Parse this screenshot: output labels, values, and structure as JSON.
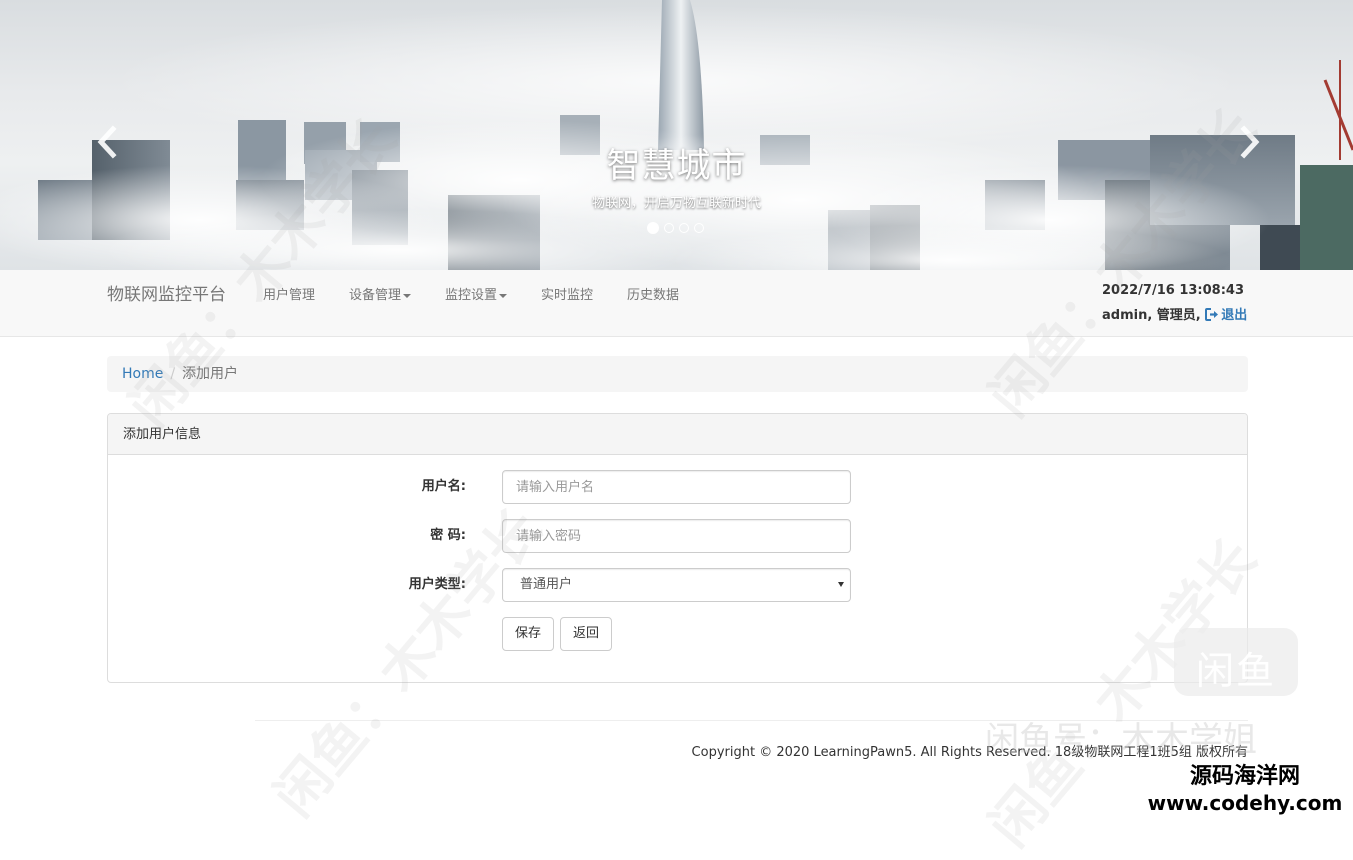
{
  "banner": {
    "title": "智慧城市",
    "subtitle": "物联网，开启万物互联新时代",
    "slide_count": 4,
    "active_slide": 1
  },
  "navbar": {
    "brand": "物联网监控平台",
    "items": [
      {
        "label": "用户管理",
        "dropdown": false
      },
      {
        "label": "设备管理",
        "dropdown": true
      },
      {
        "label": "监控设置",
        "dropdown": true
      },
      {
        "label": "实时监控",
        "dropdown": false
      },
      {
        "label": "历史数据",
        "dropdown": false
      }
    ],
    "datetime": "2022/7/16 13:08:43",
    "user": "admin, 管理员,",
    "logout": "退出"
  },
  "breadcrumb": {
    "home": "Home",
    "separator": "/",
    "current": "添加用户"
  },
  "panel": {
    "heading": "添加用户信息",
    "username_label": "用户名:",
    "username_placeholder": "请输入用户名",
    "password_label": "密 码:",
    "password_placeholder": "请输入密码",
    "usertype_label": "用户类型:",
    "usertype_selected": "普通用户",
    "save_label": "保存",
    "back_label": "返回"
  },
  "footer": {
    "copyright": "Copyright © 2020 LearningPawn5. All Rights Reserved. 18级物联网工程1班5组 版权所有"
  },
  "watermarks": {
    "badge": "闲鱼",
    "caption": "闲鱼号：木木学姐",
    "site_line1": "源码海洋网",
    "site_line2": "www.codehy.com",
    "diagonal": "闲鱼：木木学长"
  },
  "colors": {
    "link": "#337ab7",
    "navbar_bg": "#f8f8f8",
    "panel_heading_bg": "#f5f5f5"
  }
}
